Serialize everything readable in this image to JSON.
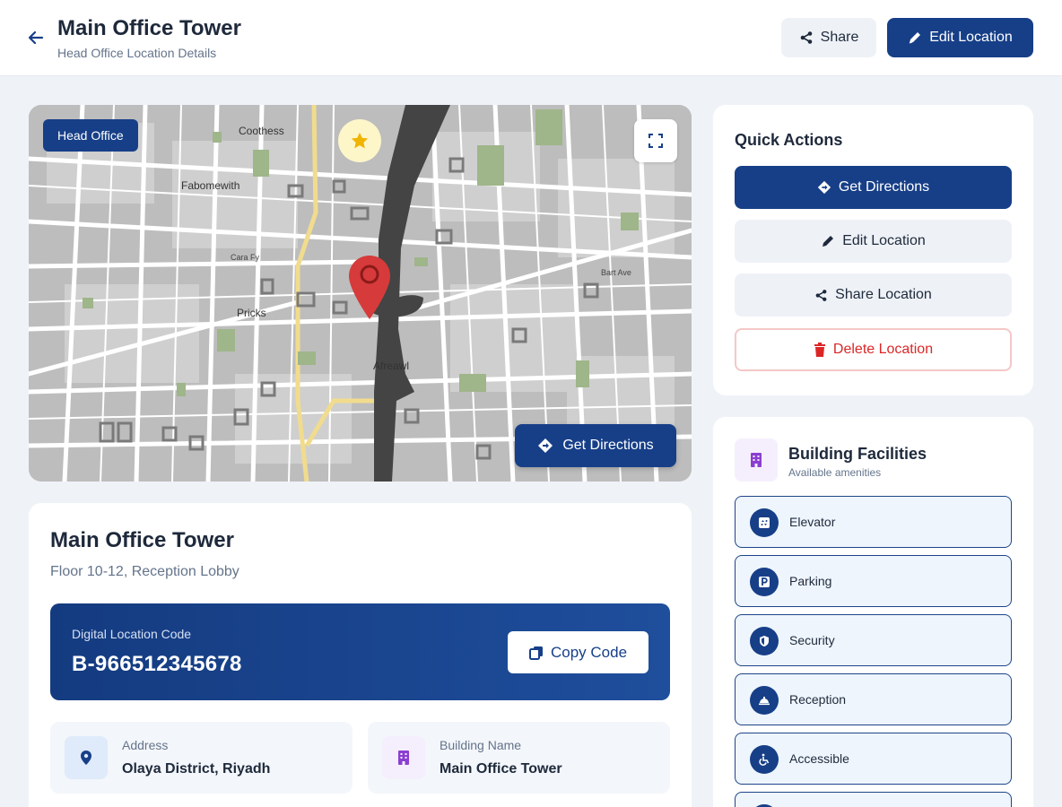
{
  "header": {
    "title": "Main Office Tower",
    "subtitle": "Head Office Location Details",
    "share_label": "Share",
    "edit_label": "Edit Location"
  },
  "map": {
    "badge": "Head Office",
    "directions_label": "Get Directions",
    "place_labels": [
      "Coothess",
      "Fabomewith",
      "Pricks",
      "Afreawl",
      "Cara Fy",
      "Bart Ave"
    ]
  },
  "location": {
    "name": "Main Office Tower",
    "floor": "Floor 10-12, Reception Lobby",
    "code_label": "Digital Location Code",
    "code_value": "B-966512345678",
    "copy_label": "Copy Code",
    "address_label": "Address",
    "address_value": "Olaya District, Riyadh",
    "building_label": "Building Name",
    "building_value": "Main Office Tower"
  },
  "quick_actions": {
    "title": "Quick Actions",
    "directions": "Get Directions",
    "edit": "Edit Location",
    "share": "Share Location",
    "delete": "Delete Location"
  },
  "facilities": {
    "title": "Building Facilities",
    "subtitle": "Available amenities",
    "items": [
      {
        "name": "Elevator",
        "icon": "elevator-icon"
      },
      {
        "name": "Parking",
        "icon": "parking-icon"
      },
      {
        "name": "Security",
        "icon": "shield-icon"
      },
      {
        "name": "Reception",
        "icon": "bell-icon"
      },
      {
        "name": "Accessible",
        "icon": "wheelchair-icon"
      }
    ]
  },
  "colors": {
    "primary": "#173f88",
    "danger": "#dc2626",
    "background": "#eff3f8",
    "pin": "#d63a3a"
  }
}
